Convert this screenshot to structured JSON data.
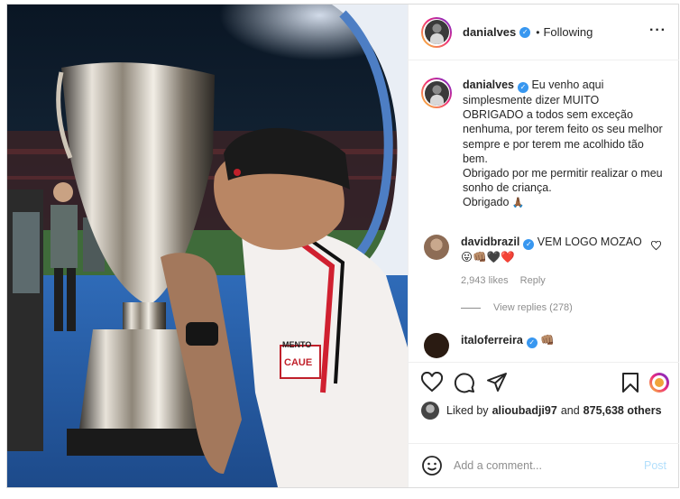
{
  "post": {
    "username": "danialves",
    "follow_status": "Following",
    "caption_text": "Eu venho aqui simplesmente dizer MUITO OBRIGADO a todos sem exceção nenhuma, por terem feito os seu melhor sempre e por terem me acolhido tão bem.",
    "caption_line2": "Obrigado por me permitir realizar o meu sonho de criança.",
    "caption_line3": "Obrigado",
    "caption_emoji": "🙏🏾",
    "photo_jersey_text_1": "MENTO",
    "photo_jersey_text_2": "CAUE"
  },
  "comments": [
    {
      "username": "davidbrazil",
      "text": "VEM LOGO MOZAO",
      "emojis": "😛👊🏽🖤❤️",
      "likes": "2,943 likes",
      "reply_label": "Reply",
      "view_replies": "View replies (278)"
    },
    {
      "username": "italoferreira",
      "emojis": "👊🏽"
    }
  ],
  "likes": {
    "prefix": "Liked by",
    "user": "alioubadji97",
    "joiner": "and",
    "count": "875,638 others"
  },
  "composer": {
    "placeholder": "Add a comment...",
    "post_label": "Post"
  },
  "colors": {
    "verified": "#3897f0",
    "post_button_disabled": "#b2dffc",
    "secondary_text": "#8e8e8e",
    "border": "#dbdbdb"
  },
  "icons": [
    "more-options-icon",
    "verified-badge-icon",
    "heart-icon",
    "comment-icon",
    "share-icon",
    "bookmark-icon",
    "emoji-icon",
    "pray-emoji-icon"
  ]
}
